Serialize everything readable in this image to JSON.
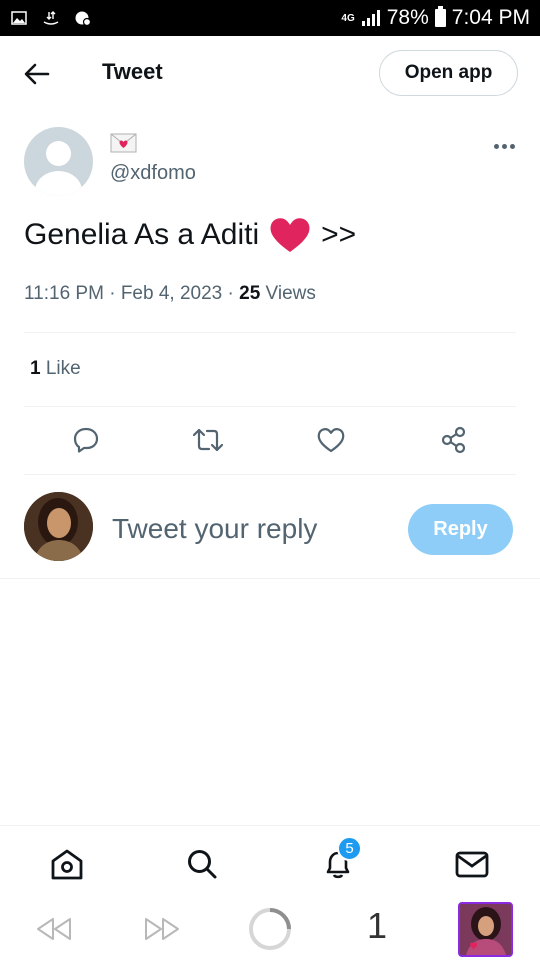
{
  "status_bar": {
    "network": "4G",
    "battery": "78%",
    "time": "7:04 PM"
  },
  "header": {
    "title": "Tweet",
    "open_app_label": "Open app",
    "back_icon": "arrow-left-icon"
  },
  "tweet": {
    "display_name_emoji": "love-letter-emoji",
    "handle": "@xdfomo",
    "text": "Genelia As a Aditi",
    "text_suffix": ">>",
    "time": "11:16 PM",
    "date": "Feb 4, 2023",
    "views_count": "25",
    "views_label": "Views",
    "likes_count": "1",
    "likes_label": "Like",
    "heart_color": "#e0245e"
  },
  "actions": [
    {
      "name": "reply",
      "icon": "comment-icon"
    },
    {
      "name": "retweet",
      "icon": "retweet-icon"
    },
    {
      "name": "like",
      "icon": "heart-outline-icon"
    },
    {
      "name": "share",
      "icon": "share-icon"
    }
  ],
  "reply_bar": {
    "placeholder": "Tweet your reply",
    "button_label": "Reply",
    "button_color": "#8ecdf8"
  },
  "bottom_nav": {
    "items": [
      "home-icon",
      "search-icon",
      "bell-icon",
      "mail-icon"
    ],
    "notification_badge": "5",
    "accent_color": "#1d9bf0"
  },
  "browser_bar": {
    "tab_count": "1"
  }
}
